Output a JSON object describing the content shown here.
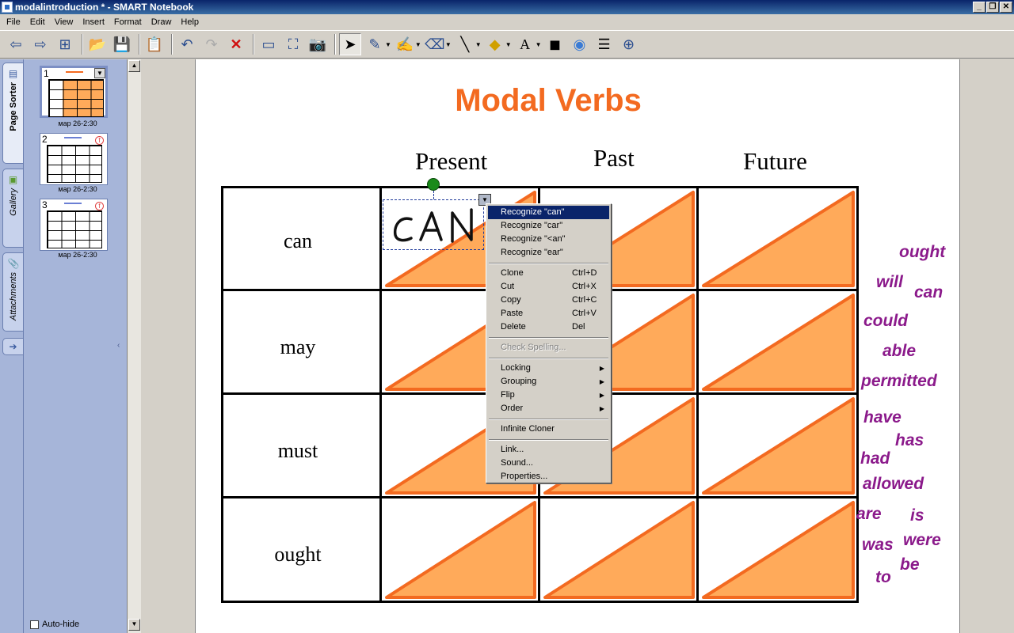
{
  "window": {
    "title": "modalintroduction * - SMART Notebook",
    "controls": [
      "_",
      "❐",
      "✕"
    ]
  },
  "menubar": [
    "File",
    "Edit",
    "View",
    "Insert",
    "Format",
    "Draw",
    "Help"
  ],
  "toolbar": {
    "icons": [
      "previous-page",
      "next-page",
      "add-page",
      "open",
      "save",
      "paste",
      "undo",
      "redo",
      "delete",
      "screen-shade",
      "full-screen",
      "capture",
      "select",
      "pen",
      "creative-pen",
      "eraser",
      "line",
      "shapes",
      "text",
      "fill",
      "properties",
      "table",
      "more"
    ]
  },
  "side_tabs": {
    "page_sorter": "Page Sorter",
    "gallery": "Gallery",
    "attachments": "Attachments"
  },
  "pages": [
    {
      "num": "1",
      "label": "мар 26-2:30"
    },
    {
      "num": "2",
      "label": "мар 26-2:30"
    },
    {
      "num": "3",
      "label": "мар 26-2:30"
    }
  ],
  "autohide": "Auto-hide",
  "slide": {
    "title": "Modal Verbs",
    "columns": [
      "Present",
      "Past",
      "Future"
    ],
    "rows": [
      "can",
      "may",
      "must",
      "ought"
    ],
    "handwriting": "CAN",
    "word_bank": [
      "ought",
      "will",
      "can",
      "could",
      "able",
      "permitted",
      "have",
      "has",
      "had",
      "allowed",
      "are",
      "is",
      "was",
      "were",
      "to",
      "be"
    ]
  },
  "context_menu": {
    "items": [
      {
        "label": "Recognize \"can\"",
        "highlighted": true
      },
      {
        "label": "Recognize \"car\""
      },
      {
        "label": "Recognize \"<an\""
      },
      {
        "label": "Recognize \"ear\""
      },
      {
        "sep": true
      },
      {
        "label": "Clone",
        "shortcut": "Ctrl+D"
      },
      {
        "label": "Cut",
        "shortcut": "Ctrl+X"
      },
      {
        "label": "Copy",
        "shortcut": "Ctrl+C"
      },
      {
        "label": "Paste",
        "shortcut": "Ctrl+V"
      },
      {
        "label": "Delete",
        "shortcut": "Del"
      },
      {
        "sep": true
      },
      {
        "label": "Check Spelling...",
        "disabled": true
      },
      {
        "sep": true
      },
      {
        "label": "Locking",
        "submenu": true
      },
      {
        "label": "Grouping",
        "submenu": true
      },
      {
        "label": "Flip",
        "submenu": true
      },
      {
        "label": "Order",
        "submenu": true
      },
      {
        "sep": true
      },
      {
        "label": "Infinite Cloner"
      },
      {
        "sep": true
      },
      {
        "label": "Link..."
      },
      {
        "label": "Sound..."
      },
      {
        "label": "Properties..."
      }
    ]
  },
  "colors": {
    "title_orange": "#f36a20",
    "triangle_fill": "#ffaa5a",
    "triangle_stroke": "#f36a20",
    "word_purple": "#8b1a8b"
  }
}
